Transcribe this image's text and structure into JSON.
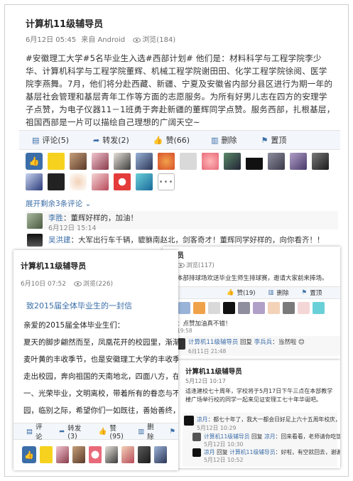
{
  "post1": {
    "title": "计算机11级辅导员",
    "date": "6月12日 05:45",
    "source": "来自 Android",
    "views": "浏览(184)",
    "body": "#安徽理工大学#5名毕业生入选#西部计划# 他们是：材料科学与工程学院李少华、计算机科学与工程学院董辉、机械工程学院谢田田、化学工程学院徐阅、医学院李燕舞。7月，他们将分赴西藏、新疆、宁夏及安徽省内部分县区进行为期一年的基层社会管理和基层青年工作等方面的志愿服务。为所有好男儿志在四方的安理学子点赞，为电子仪器11－1班勇于奔赴新疆的董辉同学点赞。服务西部，扎根基层，祖国西部是一片可以描绘自己理想的广阔天空~",
    "actions": {
      "comment": "评论(5)",
      "forward": "转发(2)",
      "like": "赞(66)",
      "delete": "删除",
      "top": "置顶"
    },
    "expand": "展开剩余3条评论",
    "comments": [
      {
        "name": "李胜",
        "text": "：董辉好样的，加油！",
        "time": "6月12日 15:14"
      },
      {
        "name": "吴洪建",
        "text": "：大军出行车千辆，貔貅南赵北，剑客奇才！董辉同学好样的，向你看齐！！"
      }
    ]
  },
  "post2": {
    "title": "计算机11级辅导员",
    "date": "6月10日 07:52",
    "views": "浏览(226)",
    "headline": "致2015届全体毕业生的一封信",
    "greeting": "亲爱的2015届全体毕业生们：",
    "lines": [
      "夏天的脚步翩然而至，凤凰花开的校园里，渐渐泛起依依惜别",
      "麦叶黄的丰收季节，也是安徽理工大学的丰收季节。你们在安徽",
      "走出校园，奔向祖国的天南地北，四面八方，在此，我们真诚地",
      "一、光荣毕业，文明离校，带着所有的眷恋与不舍，情怀与憧憬",
      "园，临别之际，希望你们一如既往，善始善终，把最美好的回忆"
    ],
    "actions": {
      "comment": "评论",
      "forward": "转发(3)",
      "like": "赞(95)",
      "delete": "删除"
    }
  },
  "post3": {
    "title_frag": "员",
    "views": "浏览(117)",
    "body": "本部排球场欢送毕业生师生排球赛，邀请大家前来捧场。",
    "actions": {
      "like": "赞(19)",
      "delete": "删除",
      "top": "置顶"
    },
    "reply_a_text": "：点赞加油真不错！",
    "reply_a_time": "19:58",
    "reply_b_name": "计算机11级辅导员",
    "reply_b_mid": "回复",
    "reply_b_target": "李兵兵",
    "reply_b_text": "：当然啦",
    "reply_b_time": "6月11日 21:48"
  },
  "post4": {
    "title": "计算机11级辅导员",
    "date": "5月12日 10:17",
    "body": "适逢建校七十周年，学校将于5月17日下午三点在本部教学楼广场举行校的同学一起来见证安理工七十年华诞吧。",
    "comments": [
      {
        "name": "凉月",
        "text": "：都七十年了，我大一都会日好足上六十五周年校庆，那会我还当保安",
        "time": "5月12日 10:29"
      },
      {
        "name": "计算机11级辅导员",
        "mid": "回复",
        "target": "凉月",
        "text": "：回来看看，老师请你吃饭。",
        "time": "5月12日 10:30"
      },
      {
        "name": "凉月",
        "mid": "回复",
        "target": "计算机11级辅导员",
        "text": "：好啦，有空就回去，谢谢老师",
        "time": "5月12日 10:52"
      }
    ]
  },
  "colors": {
    "link": "#3b6ea8",
    "action_bg": "#f3f6fa"
  }
}
